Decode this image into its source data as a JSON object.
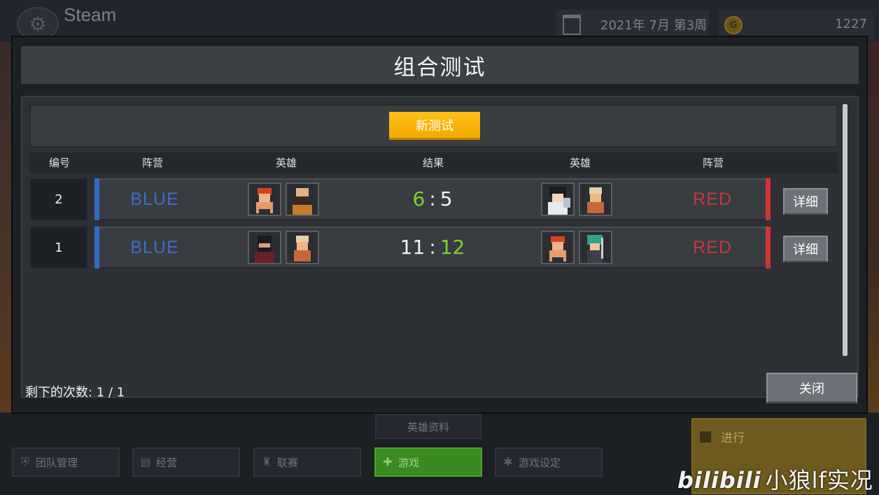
{
  "top_bar": {
    "team_name": "Steam",
    "date": "2021年 7月 第3周",
    "gold": "1227"
  },
  "modal": {
    "title": "组合测试",
    "new_test_label": "新测试",
    "columns": {
      "id": "编号",
      "faction_left": "阵营",
      "heroes_left": "英雄",
      "result": "结果",
      "heroes_right": "英雄",
      "faction_right": "阵营"
    },
    "rows": [
      {
        "id": "2",
        "left_faction": "BLUE",
        "left_heroes": [
          "red-hair-fighter-portrait",
          "bearded-monk-portrait"
        ],
        "left_score": "6",
        "separator": ":",
        "right_score": "5",
        "winner": "left",
        "right_heroes": [
          "black-hair-girl-portrait",
          "blonde-fighter-portrait"
        ],
        "right_faction": "RED",
        "detail_label": "详细"
      },
      {
        "id": "1",
        "left_faction": "BLUE",
        "left_heroes": [
          "masked-ninja-portrait",
          "blonde-fighter-portrait"
        ],
        "left_score": "11",
        "separator": ":",
        "right_score": "12",
        "winner": "right",
        "right_heroes": [
          "red-hair-fighter-portrait",
          "teal-hair-swordsman-portrait"
        ],
        "right_faction": "RED",
        "detail_label": "详细"
      }
    ],
    "remaining_label": "剩下的次数: 1 / 1",
    "close_label": "关闭"
  },
  "background": {
    "hero_info_label": "英雄资料",
    "nav": [
      {
        "label": "团队管理",
        "icon": "shield-icon"
      },
      {
        "label": "经营",
        "icon": "document-icon"
      },
      {
        "label": "联赛",
        "icon": "trophy-icon"
      },
      {
        "label": "游戏",
        "icon": "gamepad-icon",
        "active": true
      },
      {
        "label": "游戏设定",
        "icon": "gear-icon"
      }
    ],
    "progress_label": "进行"
  },
  "watermark": {
    "logo": "bilibili",
    "author": "小狼lf实况"
  },
  "colors": {
    "blue_faction": "#3a70c4",
    "red_faction": "#c63a3a",
    "win_score": "#7fd32a",
    "primary_button": "#ffb300",
    "active_nav": "#3a8a22"
  }
}
